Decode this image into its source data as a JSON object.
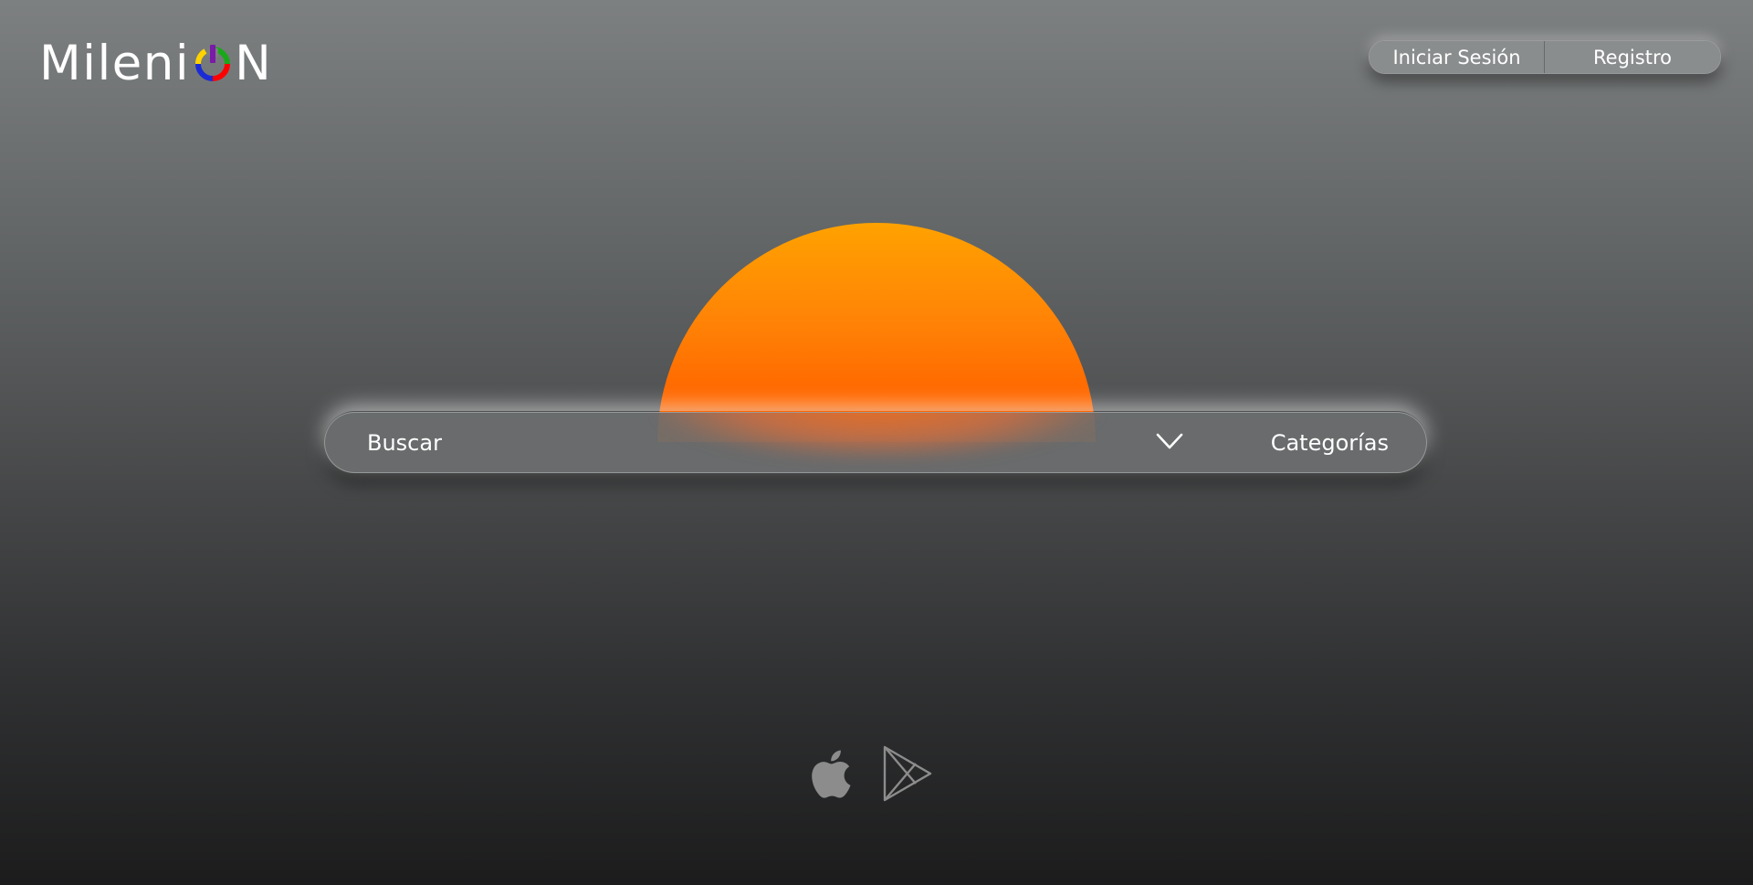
{
  "header": {
    "logo": {
      "text_before": "Mileni",
      "text_after": "N",
      "power_icon_colors": [
        "#ff0000",
        "#ffd200",
        "#1aa81a",
        "#1a2bd6",
        "#7a1aa8"
      ]
    },
    "auth": {
      "login_label": "Iniciar Sesión",
      "register_label": "Registro"
    }
  },
  "hero": {
    "sun_colors": [
      "#ffa200",
      "#ff6200"
    ]
  },
  "search": {
    "placeholder": "Buscar",
    "value": "",
    "dropdown_icon": "chevron-down-icon",
    "categories_label": "Categorías"
  },
  "stores": [
    {
      "name": "apple-store",
      "icon": "apple-icon"
    },
    {
      "name": "google-play",
      "icon": "play-store-icon"
    }
  ],
  "colors": {
    "background_top": "#7d8081",
    "background_bottom": "#1c1c1d",
    "search_bar": "#6c6e6f",
    "icon_gray": "#8c8c8c"
  }
}
